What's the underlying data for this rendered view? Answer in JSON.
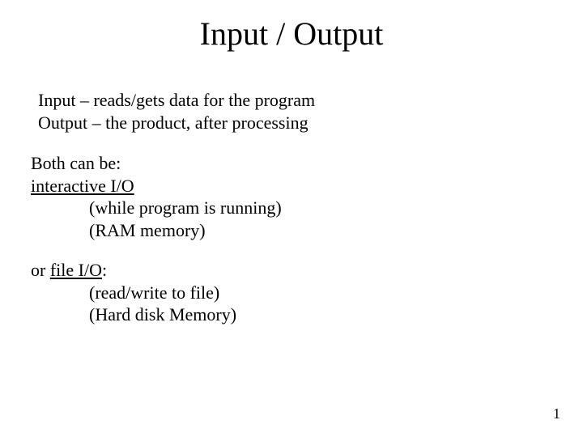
{
  "title": "Input / Output",
  "defs": {
    "input": "Input – reads/gets data for the program",
    "output": "Output – the product, after processing"
  },
  "both_intro": "Both can be:",
  "interactive": {
    "label": "interactive I/O",
    "d1": "(while program is running)",
    "d2": "(RAM memory)"
  },
  "file": {
    "prefix": "or ",
    "label": "file I/O",
    "suffix": ":",
    "d1": "(read/write to file)",
    "d2": "(Hard disk Memory)"
  },
  "page_number": "1"
}
